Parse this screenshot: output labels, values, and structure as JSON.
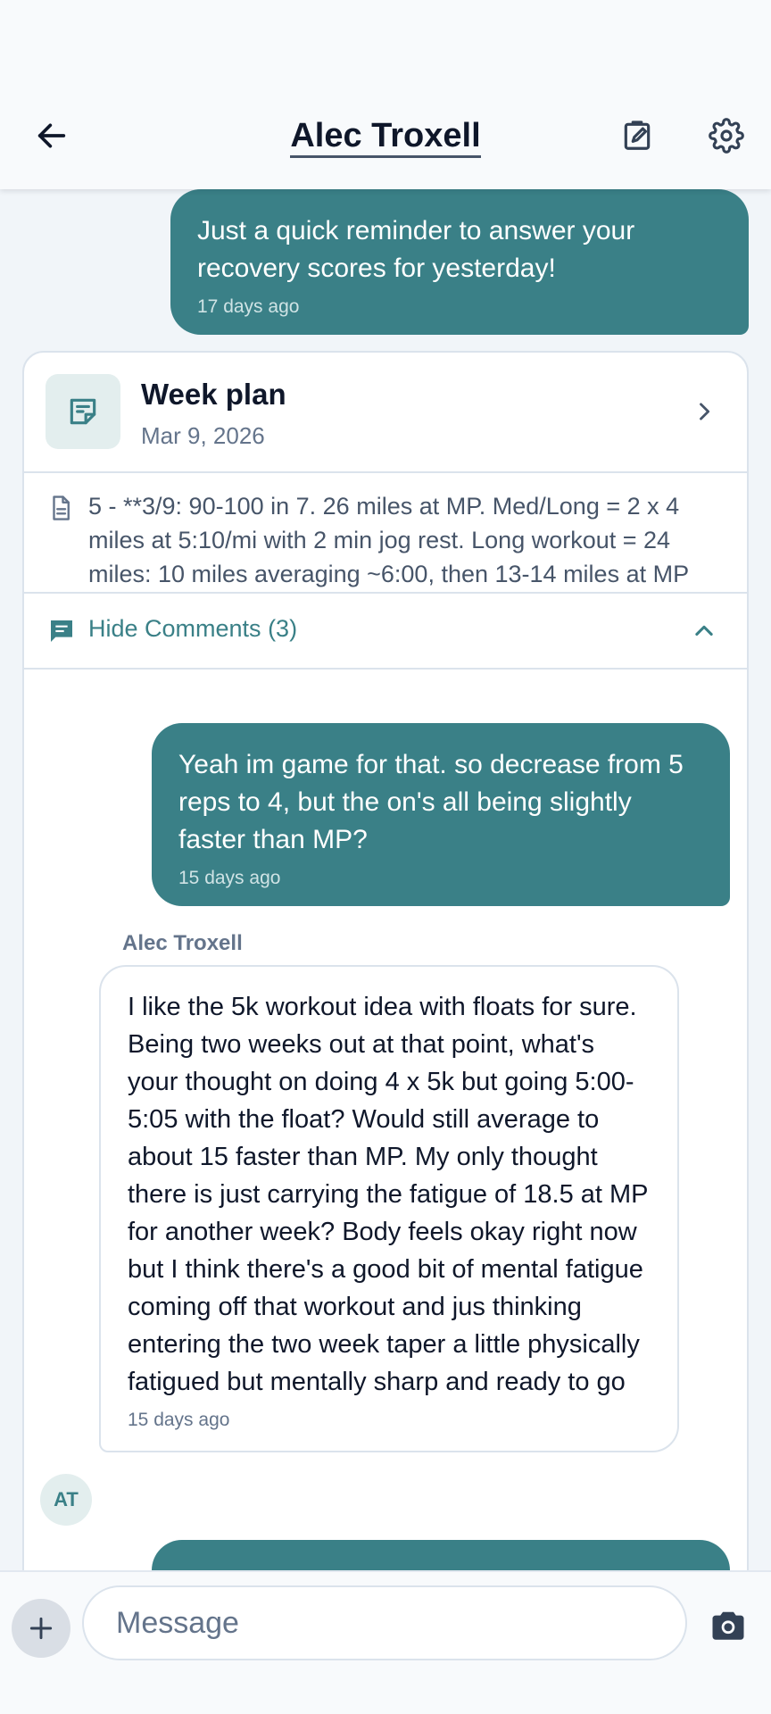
{
  "header": {
    "title": "Alec Troxell",
    "icons": {
      "back": "arrow-left-icon",
      "edit": "edit-note-icon",
      "settings": "gear-icon"
    }
  },
  "messages": {
    "reminder": {
      "text": "Just a quick reminder to answer your recovery scores for yesterday!",
      "time": "17 days ago"
    }
  },
  "plan_card": {
    "title": "Week plan",
    "date": "Mar 9, 2026",
    "notes": "5 - **3/9: 90-100 in 7. 26 miles at MP. Med/Long = 2 x 4 miles at 5:10/mi with 2 min jog rest. Long workout = 24 miles: 10 miles averaging ~6:00, then 13-14 miles at MP",
    "comments_toggle": "Hide Comments (3)",
    "comments": [
      {
        "direction": "outgoing",
        "text": "Yeah im game for that. so decrease from 5 reps to 4, but the on's all being slightly faster than MP?",
        "time": "15 days ago"
      },
      {
        "direction": "incoming",
        "sender": "Alec Troxell",
        "initials": "AT",
        "text": "I like the 5k workout idea with floats for sure. Being two weeks out at that point, what's your thought on doing 4 x 5k but going 5:00-5:05 with the float? Would still average to about 15 faster than MP. My only thought there is just carrying the fatigue of 18.5 at MP for another week? Body feels okay right now but I think there's a good bit of mental fatigue coming off that workout and jus thinking entering the two week taper a little physically fatigued but mentally sharp and ready to go",
        "time": "15 days ago"
      }
    ]
  },
  "composer": {
    "placeholder": "Message",
    "value": ""
  },
  "colors": {
    "accent": "#3a8087",
    "background": "#f1f5f9",
    "card_border": "#dbe3ec"
  }
}
